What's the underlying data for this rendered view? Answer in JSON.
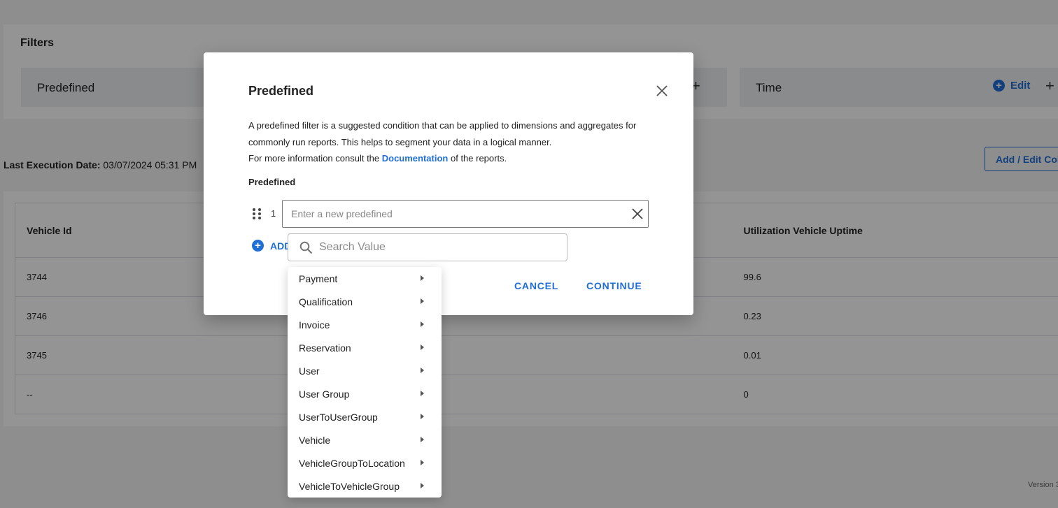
{
  "filters": {
    "title": "Filters",
    "predefined_label": "Predefined",
    "time_label": "Time",
    "edit_label": "Edit",
    "plus": "+"
  },
  "report": {
    "last_execution_label": "Last Execution Date:",
    "last_execution_value": "03/07/2024 05:31 PM",
    "add_edit_button": "Add / Edit Columns"
  },
  "table": {
    "columns": [
      "Vehicle Id",
      "Utilization Vehicle Uptime"
    ],
    "rows": [
      [
        "3744",
        "99.6"
      ],
      [
        "3746",
        "0.23"
      ],
      [
        "3745",
        "0.01"
      ],
      [
        "--",
        "0"
      ]
    ]
  },
  "footer": {
    "version": "Version 3"
  },
  "modal": {
    "title": "Predefined",
    "desc_line1": "A predefined filter is a suggested condition that can be applied to dimensions and aggregates for commonly run reports. This helps to segment your data in a logical manner.",
    "desc_prefix": "For more information consult the ",
    "desc_link": "Documentation",
    "desc_suffix": " of the reports.",
    "field_label": "Predefined",
    "row_number": "1",
    "input_value": "",
    "input_placeholder": "Enter a new predefined",
    "add_label": "ADD",
    "cancel": "CANCEL",
    "continue": "CONTINUE"
  },
  "search": {
    "value": "",
    "placeholder": "Search Value"
  },
  "dropdown": {
    "items": [
      "Payment",
      "Qualification",
      "Invoice",
      "Reservation",
      "User",
      "User Group",
      "UserToUserGroup",
      "Vehicle",
      "VehicleGroupToLocation",
      "VehicleToVehicleGroup"
    ]
  },
  "colors": {
    "accent": "#1f6fd6",
    "overlay": "rgba(0,0,0,0.42)"
  }
}
